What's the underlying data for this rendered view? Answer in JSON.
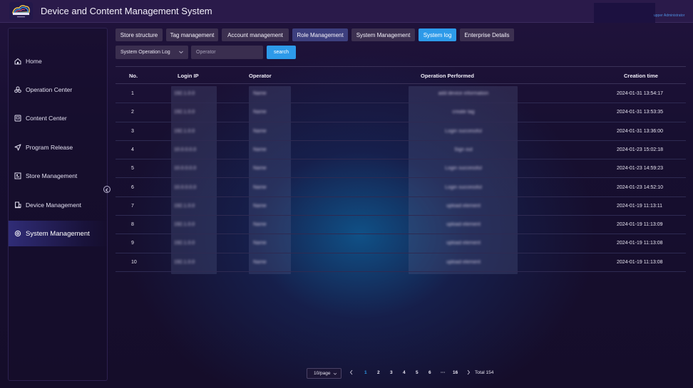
{
  "header": {
    "logo_text": "Snowblue Cloud",
    "title": "Device and Content Management System",
    "user_label": "upper Administrator"
  },
  "sidebar": {
    "items": [
      {
        "label": "Home",
        "icon": "home-icon"
      },
      {
        "label": "Operation Center",
        "icon": "operation-icon"
      },
      {
        "label": "Content Center",
        "icon": "content-icon"
      },
      {
        "label": "Program Release",
        "icon": "send-icon"
      },
      {
        "label": "Store Management",
        "icon": "store-icon"
      },
      {
        "label": "Device Management",
        "icon": "device-icon"
      },
      {
        "label": "System Management",
        "icon": "gear-icon",
        "active": true
      }
    ]
  },
  "tabs": [
    {
      "label": "Store structure"
    },
    {
      "label": "Tag management"
    },
    {
      "label": "Account management"
    },
    {
      "label": "Role Management",
      "highlighted": true
    },
    {
      "label": "System Management"
    },
    {
      "label": "System log",
      "active": true
    },
    {
      "label": "Enterprise Details"
    }
  ],
  "filters": {
    "log_type": "System Operation Log",
    "operator_placeholder": "Operator",
    "search_label": "search"
  },
  "table": {
    "columns": [
      "No.",
      "Login IP",
      "Operator",
      "Operation Performed",
      "Creation time"
    ],
    "rows": [
      {
        "no": "1",
        "ip": "192.1.0.0",
        "operator": "Name",
        "operation": "add device information",
        "time": "2024-01-31 13:54:17"
      },
      {
        "no": "2",
        "ip": "192.1.0.0",
        "operator": "Name",
        "operation": "create tag",
        "time": "2024-01-31 13:53:35"
      },
      {
        "no": "3",
        "ip": "192.1.0.0",
        "operator": "Name",
        "operation": "Login successful",
        "time": "2024-01-31 13:36:00"
      },
      {
        "no": "4",
        "ip": "10.0.0.0.0",
        "operator": "Name",
        "operation": "Sign out",
        "time": "2024-01-23 15:02:18"
      },
      {
        "no": "5",
        "ip": "10.0.0.0.0",
        "operator": "Name",
        "operation": "Login successful",
        "time": "2024-01-23 14:59:23"
      },
      {
        "no": "6",
        "ip": "10.0.0.0.0",
        "operator": "Name",
        "operation": "Login successful",
        "time": "2024-01-23 14:52:10"
      },
      {
        "no": "7",
        "ip": "192.1.0.0",
        "operator": "Name",
        "operation": "upload element",
        "time": "2024-01-19 11:13:11"
      },
      {
        "no": "8",
        "ip": "192.1.0.0",
        "operator": "Name",
        "operation": "upload element",
        "time": "2024-01-19 11:13:09"
      },
      {
        "no": "9",
        "ip": "192.1.0.0",
        "operator": "Name",
        "operation": "upload element",
        "time": "2024-01-19 11:13:08"
      },
      {
        "no": "10",
        "ip": "192.1.0.0",
        "operator": "Name",
        "operation": "upload element",
        "time": "2024-01-19 11:13:08"
      }
    ]
  },
  "pagination": {
    "page_size": "10/page",
    "pages": [
      "1",
      "2",
      "3",
      "4",
      "5",
      "6",
      "···",
      "16"
    ],
    "current_page": "1",
    "total": "Total 154"
  },
  "colors": {
    "accent": "#2d9ae9",
    "background": "#150d2a",
    "tab_bg": "#3c3050"
  }
}
